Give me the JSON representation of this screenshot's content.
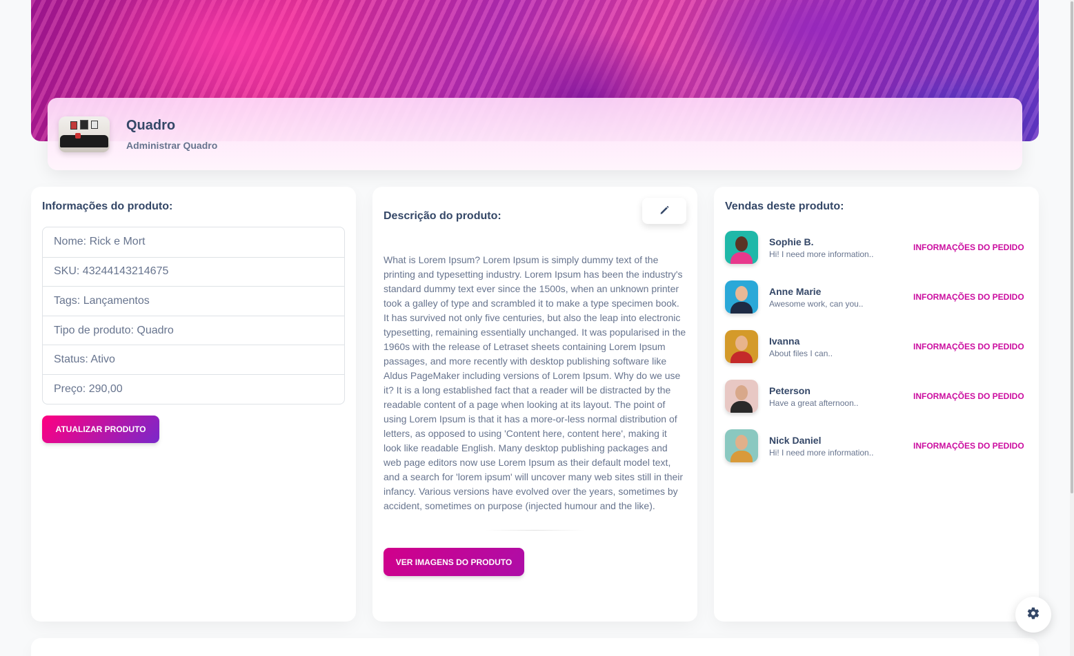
{
  "header": {
    "title": "Quadro",
    "subtitle": "Administrar Quadro",
    "thumbnail_icon": "product-image"
  },
  "info_card": {
    "title": "Informações do produto:",
    "items": [
      "Nome: Rick e Mort",
      "SKU: 43244143214675",
      "Tags: Lançamentos",
      "Tipo de produto: Quadro",
      "Status: Ativo",
      "Preço: 290,00"
    ],
    "update_button": "ATUALIZAR PRODUTO"
  },
  "description_card": {
    "title": "Descrição do produto:",
    "edit_icon": "pencil-icon",
    "text": "What is Lorem Ipsum? Lorem Ipsum is simply dummy text of the printing and typesetting industry. Lorem Ipsum has been the industry's standard dummy text ever since the 1500s, when an unknown printer took a galley of type and scrambled it to make a type specimen book. It has survived not only five centuries, but also the leap into electronic typesetting, remaining essentially unchanged. It was popularised in the 1960s with the release of Letraset sheets containing Lorem Ipsum passages, and more recently with desktop publishing software like Aldus PageMaker including versions of Lorem Ipsum. Why do we use it? It is a long established fact that a reader will be distracted by the readable content of a page when looking at its layout. The point of using Lorem Ipsum is that it has a more-or-less normal distribution of letters, as opposed to using 'Content here, content here', making it look like readable English. Many desktop publishing packages and web page editors now use Lorem Ipsum as their default model text, and a search for 'lorem ipsum' will uncover many web sites still in their infancy. Various versions have evolved over the years, sometimes by accident, sometimes on purpose (injected humour and the like).",
    "images_button": "VER IMAGENS DO PRODUTO"
  },
  "sales_card": {
    "title": "Vendas deste produto:",
    "link_label": "INFORMAÇÕES DO PEDIDO",
    "items": [
      {
        "name": "Sophie B.",
        "message": "Hi! I need more information..",
        "bg": "#1fb8a8",
        "skin": "#5a3424",
        "shirt": "#e8398c"
      },
      {
        "name": "Anne Marie",
        "message": "Awesome work, can you..",
        "bg": "#2aa8d8",
        "skin": "#e8b896",
        "shirt": "#1e2a44"
      },
      {
        "name": "Ivanna",
        "message": "About files I can..",
        "bg": "#d49a2a",
        "skin": "#e8b48c",
        "shirt": "#c42a2a"
      },
      {
        "name": "Peterson",
        "message": "Have a great afternoon..",
        "bg": "#e8c8c4",
        "skin": "#d8a88a",
        "shirt": "#2a2a2a"
      },
      {
        "name": "Nick Daniel",
        "message": "Hi! I need more information..",
        "bg": "#8ac8c0",
        "skin": "#e0b08a",
        "shirt": "#d89a3a"
      }
    ]
  },
  "settings_icon": "gear-icon",
  "colors": {
    "accent": "#cb0c9f",
    "gradient_start": "#ff0080",
    "gradient_end": "#7928ca",
    "text": "#344767",
    "muted": "#67748e"
  }
}
